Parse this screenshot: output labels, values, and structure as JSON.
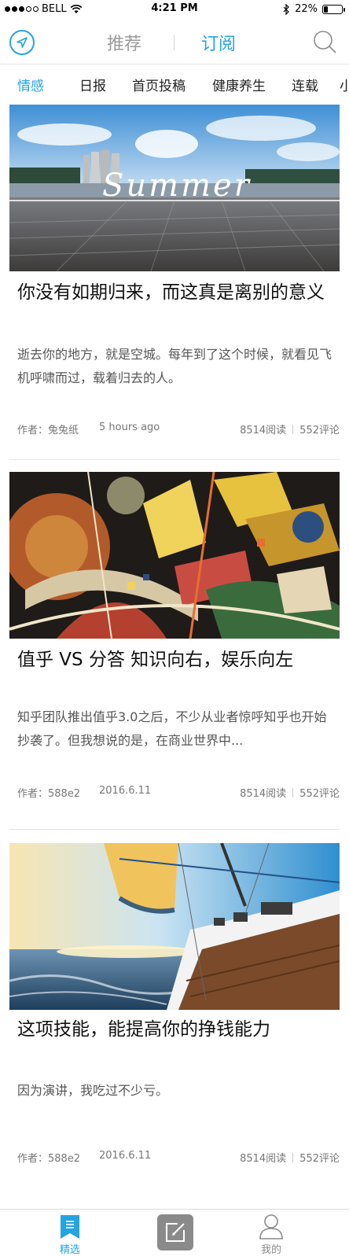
{
  "status_bar": {
    "carrier": "BELL",
    "time": "4:21 PM",
    "battery": "22%",
    "battery_level": 0.22
  },
  "top_nav": {
    "location_icon": "location-arrow-icon",
    "tabs": [
      {
        "label": "推荐",
        "active": false
      },
      {
        "label": "订阅",
        "active": true
      }
    ],
    "search_icon": "search-icon"
  },
  "categories": [
    {
      "label": "情感",
      "active": true
    },
    {
      "label": "日报"
    },
    {
      "label": "首页投稿"
    },
    {
      "label": "健康养生"
    },
    {
      "label": "连载"
    },
    {
      "label": "小"
    }
  ],
  "articles": [
    {
      "image": "summer-seaside-boardwalk-photo",
      "image_script_text": "Summer",
      "title": "你没有如期归来，而这真是离别的意义",
      "summary": "逝去你的地方，就是空城。每年到了这个时候，就看见飞机呼啸而过，载着归去的人。",
      "author": "作者：兔兔纸",
      "date": "5 hours ago",
      "reads": "8514阅读",
      "comments": "552评论"
    },
    {
      "image": "abstract-kandinsky-painting",
      "title": "值乎 VS 分答 知识向右，娱乐向左",
      "summary": "知乎团队推出值乎3.0之后，不少从业者惊呼知乎也开始抄袭了。但我想说的是，在商业世界中...",
      "author": "作者：588e2",
      "date": "2016.6.11",
      "reads": "8514阅读",
      "comments": "552评论"
    },
    {
      "image": "sailboat-sunset-sea-photo",
      "title": "这项技能，能提高你的挣钱能力",
      "summary": "因为演讲，我吃过不少亏。",
      "author": "作者：588e2",
      "date": "2016.6.11",
      "reads": "8514阅读",
      "comments": "552评论"
    }
  ],
  "tab_bar": {
    "items": [
      {
        "label": "精选",
        "icon": "bookmark-list-icon",
        "active": true
      },
      {
        "label": "",
        "icon": "compose-icon",
        "active": false
      },
      {
        "label": "我的",
        "icon": "user-icon",
        "active": false
      }
    ]
  },
  "colors": {
    "accent": "#26a4e0",
    "inactive_tab": "#9a9a9a",
    "text": "#222222",
    "muted": "#777777"
  }
}
